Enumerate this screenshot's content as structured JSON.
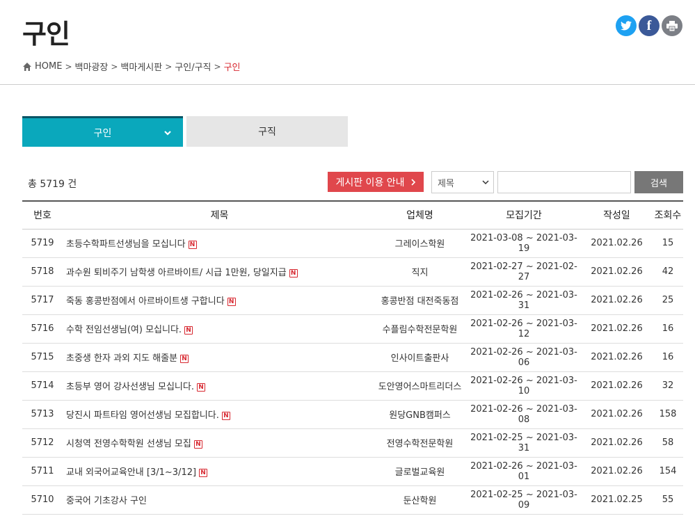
{
  "page": {
    "title": "구인"
  },
  "breadcrumb": {
    "items": [
      "HOME",
      "백마광장",
      "백마게시판",
      "구인/구직"
    ],
    "current": "구인"
  },
  "share": {
    "twitter_icon": "twitter-icon",
    "facebook_icon": "facebook-icon",
    "print_icon": "print-icon"
  },
  "tabs": [
    {
      "label": "구인",
      "active": true
    },
    {
      "label": "구직",
      "active": false
    }
  ],
  "board": {
    "total_text": "총 5719 건",
    "guide_button": "게시판 이용 안내",
    "search_select": "제목",
    "search_placeholder": "",
    "search_button": "검색",
    "new_badge": "N",
    "columns": [
      "번호",
      "제목",
      "업체명",
      "모집기간",
      "작성일",
      "조회수"
    ],
    "rows": [
      {
        "no": "5719",
        "title": "초등수학파트선생님을 모십니다",
        "company": "그레이스학원",
        "period": "2021-03-08 ~ 2021-03-19",
        "date": "2021.02.26",
        "views": "15",
        "is_new": true
      },
      {
        "no": "5718",
        "title": "과수원 퇴비주기 남학생 아르바이트/ 시급 1만원, 당일지급",
        "company": "직지",
        "period": "2021-02-27 ~ 2021-02-27",
        "date": "2021.02.26",
        "views": "42",
        "is_new": true
      },
      {
        "no": "5717",
        "title": "죽동 홍콩반점에서 아르바이트생 구합니다",
        "company": "홍콩반점 대전죽동점",
        "period": "2021-02-26 ~ 2021-03-31",
        "date": "2021.02.26",
        "views": "25",
        "is_new": true
      },
      {
        "no": "5716",
        "title": "수학 전임선생님(여) 모십니다.",
        "company": "수플림수학전문학원",
        "period": "2021-02-26 ~ 2021-03-12",
        "date": "2021.02.26",
        "views": "16",
        "is_new": true
      },
      {
        "no": "5715",
        "title": "초중생 한자 과외 지도 해줄분",
        "company": "인사이트출판사",
        "period": "2021-02-26 ~ 2021-03-06",
        "date": "2021.02.26",
        "views": "16",
        "is_new": true
      },
      {
        "no": "5714",
        "title": "초등부 영어 강사선생님 모십니다.",
        "company": "도안영어스마트리더스",
        "period": "2021-02-26 ~ 2021-03-10",
        "date": "2021.02.26",
        "views": "32",
        "is_new": true
      },
      {
        "no": "5713",
        "title": "당진시 파트타임 영어선생님 모집합니다.",
        "company": "원당GNB캠퍼스",
        "period": "2021-02-26 ~ 2021-03-08",
        "date": "2021.02.26",
        "views": "158",
        "is_new": true
      },
      {
        "no": "5712",
        "title": "시청역 전영수학학원 선생님 모집",
        "company": "전영수학전문학원",
        "period": "2021-02-25 ~ 2021-03-31",
        "date": "2021.02.26",
        "views": "58",
        "is_new": true
      },
      {
        "no": "5711",
        "title": "교내 외국어교육안내 [3/1~3/12]",
        "company": "글로벌교육원",
        "period": "2021-02-26 ~ 2021-03-01",
        "date": "2021.02.26",
        "views": "154",
        "is_new": true
      },
      {
        "no": "5710",
        "title": "중국어 기초강사 구인",
        "company": "둔산학원",
        "period": "2021-02-25 ~ 2021-03-09",
        "date": "2021.02.25",
        "views": "55",
        "is_new": false
      }
    ]
  }
}
